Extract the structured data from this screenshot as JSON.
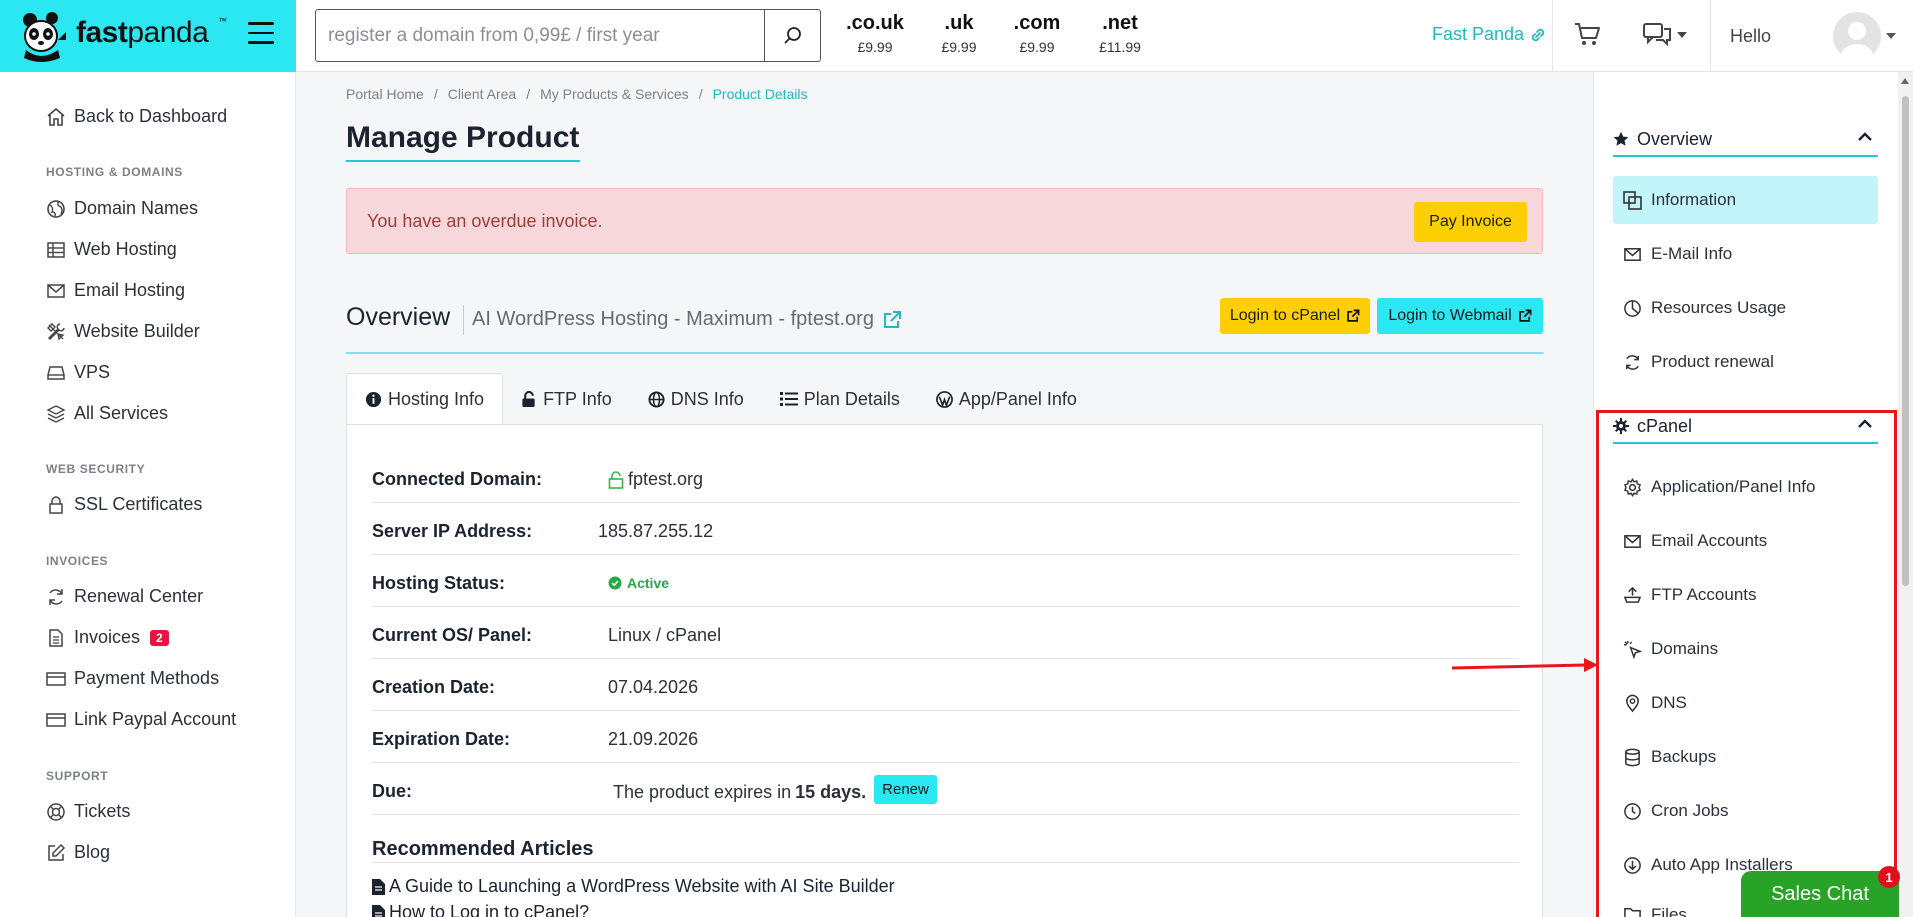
{
  "header": {
    "brand_bold": "fast",
    "brand_light": "panda",
    "brand_tm": "™",
    "search_placeholder": "register a domain from 0,99£ / first year",
    "tlds": [
      {
        "ext": ".co.uk",
        "price": "£9.99"
      },
      {
        "ext": ".uk",
        "price": "£9.99"
      },
      {
        "ext": ".com",
        "price": "£9.99"
      },
      {
        "ext": ".net",
        "price": "£11.99"
      }
    ],
    "fastpanda_link": "Fast Panda",
    "hello": "Hello"
  },
  "sidebar": {
    "back": "Back to Dashboard",
    "sections": {
      "hosting": "HOSTING & DOMAINS",
      "security": "WEB SECURITY",
      "invoices": "INVOICES",
      "support": "SUPPORT"
    },
    "items": {
      "domain_names": "Domain Names",
      "web_hosting": "Web Hosting",
      "email_hosting": "Email Hosting",
      "website_builder": "Website Builder",
      "vps": "VPS",
      "all_services": "All Services",
      "ssl": "SSL Certificates",
      "renewal_center": "Renewal Center",
      "invoices": "Invoices",
      "invoices_badge": "2",
      "payment_methods": "Payment Methods",
      "paypal": "Link Paypal Account",
      "tickets": "Tickets",
      "blog": "Blog"
    }
  },
  "breadcrumb": [
    "Portal Home",
    "/",
    "Client Area",
    "/",
    "My Products & Services",
    "/",
    "Product Details"
  ],
  "main": {
    "title": "Manage Product",
    "alert_text": "You have an overdue invoice.",
    "pay_invoice": "Pay Invoice",
    "overview_title": "Overview",
    "overview_sub": "AI WordPress Hosting - Maximum - fptest.org",
    "login_cpanel": "Login to cPanel",
    "login_webmail": "Login to Webmail",
    "tabs": [
      "Hosting Info",
      "FTP Info",
      "DNS Info",
      "Plan Details",
      "App/Panel Info"
    ],
    "rows": {
      "domain_label": "Connected Domain:",
      "domain_value": "fptest.org",
      "ip_label": "Server IP Address:",
      "ip_value": "185.87.255.12",
      "status_label": "Hosting Status:",
      "status_value": "Active",
      "os_label": "Current OS/ Panel:",
      "os_value": "Linux / cPanel",
      "created_label": "Creation Date:",
      "created_value": "07.04.2026",
      "expires_label": "Expiration Date:",
      "expires_value": "21.09.2026",
      "due_label": "Due:",
      "due_prefix": "The product expires in",
      "due_days": "15 days.",
      "renew": "Renew"
    },
    "recommended_title": "Recommended Articles",
    "articles": [
      "A Guide to Launching a WordPress Website with AI Site Builder",
      "How to Log in to cPanel?"
    ]
  },
  "rightbar": {
    "overview_head": "Overview",
    "overview_items": [
      "Information",
      "E-Mail Info",
      "Resources Usage",
      "Product renewal"
    ],
    "cpanel_head": "cPanel",
    "cpanel_items": [
      "Application/Panel Info",
      "Email Accounts",
      "FTP Accounts",
      "Domains",
      "DNS",
      "Backups",
      "Cron Jobs",
      "Auto App Installers",
      "Files"
    ]
  },
  "chat": {
    "label": "Sales Chat",
    "badge": "1"
  },
  "colors": {
    "brand_cyan": "#2ae7f2",
    "accent_teal": "#1fb8c4",
    "yellow_button": "#ffcf06",
    "alert_bg": "#f8d7da",
    "highlight_red": "#e8151a",
    "chat_green": "#28a328"
  }
}
